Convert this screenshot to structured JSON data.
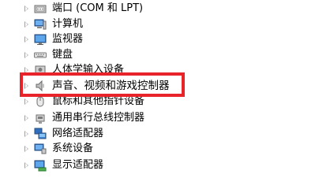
{
  "device_tree": {
    "items": [
      {
        "label": "端口 (COM 和 LPT)",
        "icon": "port-icon"
      },
      {
        "label": "计算机",
        "icon": "computer-icon"
      },
      {
        "label": "监视器",
        "icon": "monitor-icon"
      },
      {
        "label": "键盘",
        "icon": "keyboard-icon"
      },
      {
        "label": "人体学输入设备",
        "icon": "hid-icon"
      },
      {
        "label": "声音、视频和游戏控制器",
        "icon": "speaker-icon"
      },
      {
        "label": "鼠标和其他指针设备",
        "icon": "mouse-icon"
      },
      {
        "label": "通用串行总线控制器",
        "icon": "usb-icon"
      },
      {
        "label": "网络适配器",
        "icon": "network-adapter-icon"
      },
      {
        "label": "系统设备",
        "icon": "system-device-icon"
      },
      {
        "label": "显示适配器",
        "icon": "display-adapter-icon"
      }
    ]
  },
  "highlight": {
    "color": "#e8232a",
    "target_index": 5
  }
}
